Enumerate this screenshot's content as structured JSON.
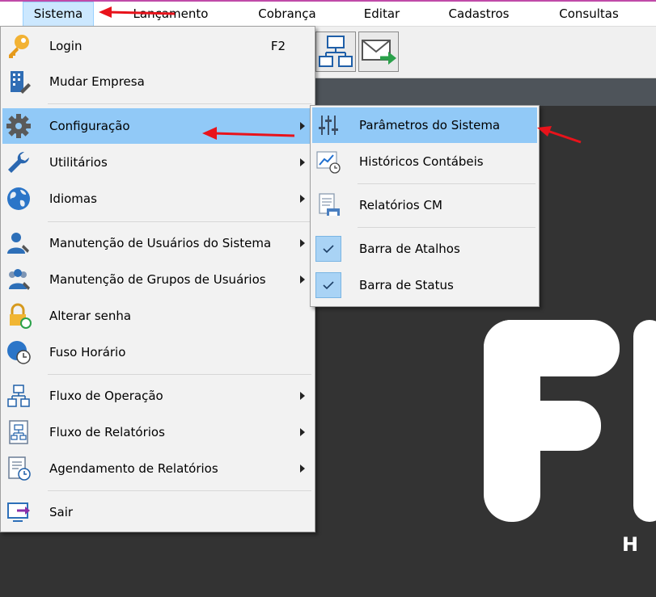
{
  "menubar": {
    "items": [
      {
        "label": "Sistema"
      },
      {
        "label": "Lançamento"
      },
      {
        "label": "Cobrança"
      },
      {
        "label": "Editar"
      },
      {
        "label": "Cadastros"
      },
      {
        "label": "Consultas"
      }
    ]
  },
  "sistema_menu": {
    "items": [
      {
        "label": "Login",
        "shortcut": "F2",
        "icon": "key-icon"
      },
      {
        "label": "Mudar Empresa",
        "icon": "building-edit-icon"
      },
      {
        "label": "Configuração",
        "icon": "gear-icon"
      },
      {
        "label": "Utilitários",
        "icon": "wrench-icon"
      },
      {
        "label": "Idiomas",
        "icon": "globe-icon"
      },
      {
        "label": "Manutenção de Usuários do Sistema",
        "icon": "user-wrench-icon"
      },
      {
        "label": "Manutenção de Grupos de Usuários",
        "icon": "group-wrench-icon"
      },
      {
        "label": "Alterar senha",
        "icon": "lock-refresh-icon"
      },
      {
        "label": "Fuso Horário",
        "icon": "globe-clock-icon"
      },
      {
        "label": "Fluxo de Operação",
        "icon": "flowchart-icon"
      },
      {
        "label": "Fluxo de Relatórios",
        "icon": "report-flow-icon"
      },
      {
        "label": "Agendamento de Relatórios",
        "icon": "report-schedule-icon"
      },
      {
        "label": "Sair",
        "icon": "exit-icon"
      }
    ]
  },
  "config_submenu": {
    "items": [
      {
        "label": "Parâmetros do Sistema",
        "icon": "sliders-icon"
      },
      {
        "label": "Históricos Contábeis",
        "icon": "chart-clock-icon"
      },
      {
        "label": "Relatórios CM",
        "icon": "report-printer-icon"
      },
      {
        "label": "Barra de Atalhos",
        "checked": true
      },
      {
        "label": "Barra de Status",
        "checked": true
      }
    ]
  },
  "logo": {
    "subtitle_letter": "H"
  },
  "colors": {
    "highlight": "#91c9f7",
    "annotation_arrow": "#e8131b",
    "menubar_active": "#cce8ff"
  }
}
